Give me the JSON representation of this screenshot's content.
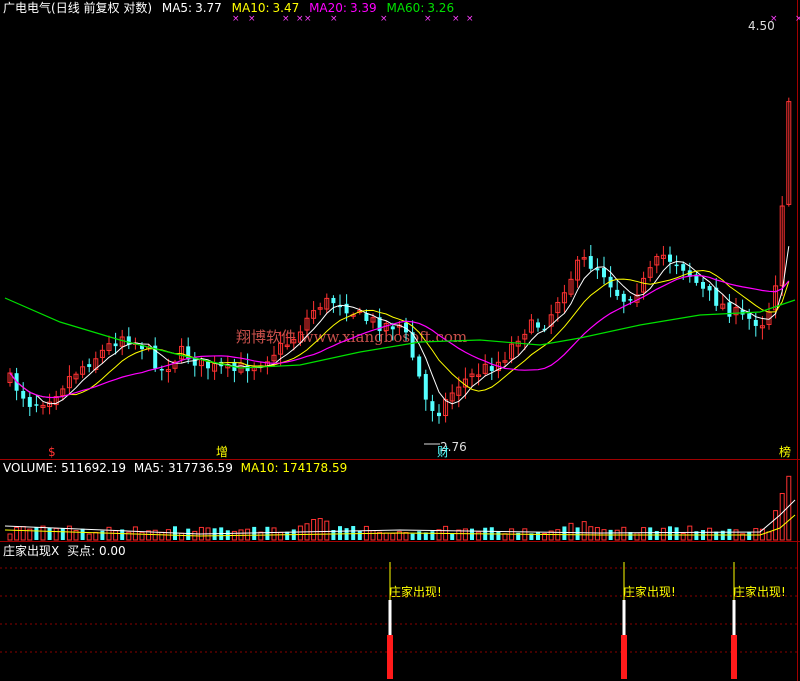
{
  "colors": {
    "background": "#000000",
    "panel_border": "#a00000",
    "up_candle": "#ff3232",
    "down_candle": "#54ffff",
    "ma5": "#ffffff",
    "ma10": "#ffff00",
    "ma20": "#ff00ff",
    "ma60": "#00e000",
    "signal_text": "#ffff00",
    "watermark": "#c8504b"
  },
  "price_panel": {
    "stock_name": "广电电气",
    "mode": "(日线 前复权 对数)",
    "ma5": {
      "label": "MA5:",
      "value": "3.77"
    },
    "ma10": {
      "label": "MA10:",
      "value": "3.47"
    },
    "ma20": {
      "label": "MA20:",
      "value": "3.39"
    },
    "ma60": {
      "label": "MA60:",
      "value": "3.26"
    },
    "high_label": "4.50",
    "low_label": "2.76",
    "marker_s": "$",
    "marker_zeng": "增",
    "marker_cai": "财",
    "marker_bang": "榜",
    "watermark": "翔博软件  www.xiangbosoft.com"
  },
  "volume_panel": {
    "volume": {
      "label": "VOLUME:",
      "value": "511692.19"
    },
    "ma5": {
      "label": "MA5:",
      "value": "317736.59"
    },
    "ma10": {
      "label": "MA10:",
      "value": "174178.59"
    }
  },
  "indicator_panel": {
    "name": "庄家出现X",
    "buy": {
      "label": "买点:",
      "value": "0.00"
    },
    "signal_text": "庄家出现!",
    "signal_text_2": "庄家出现!",
    "signal_text_3": "庄家出现!"
  },
  "chart_data": {
    "type": "candlestick",
    "price_range": [
      2.76,
      4.5
    ],
    "buy_signals_count": 3
  }
}
